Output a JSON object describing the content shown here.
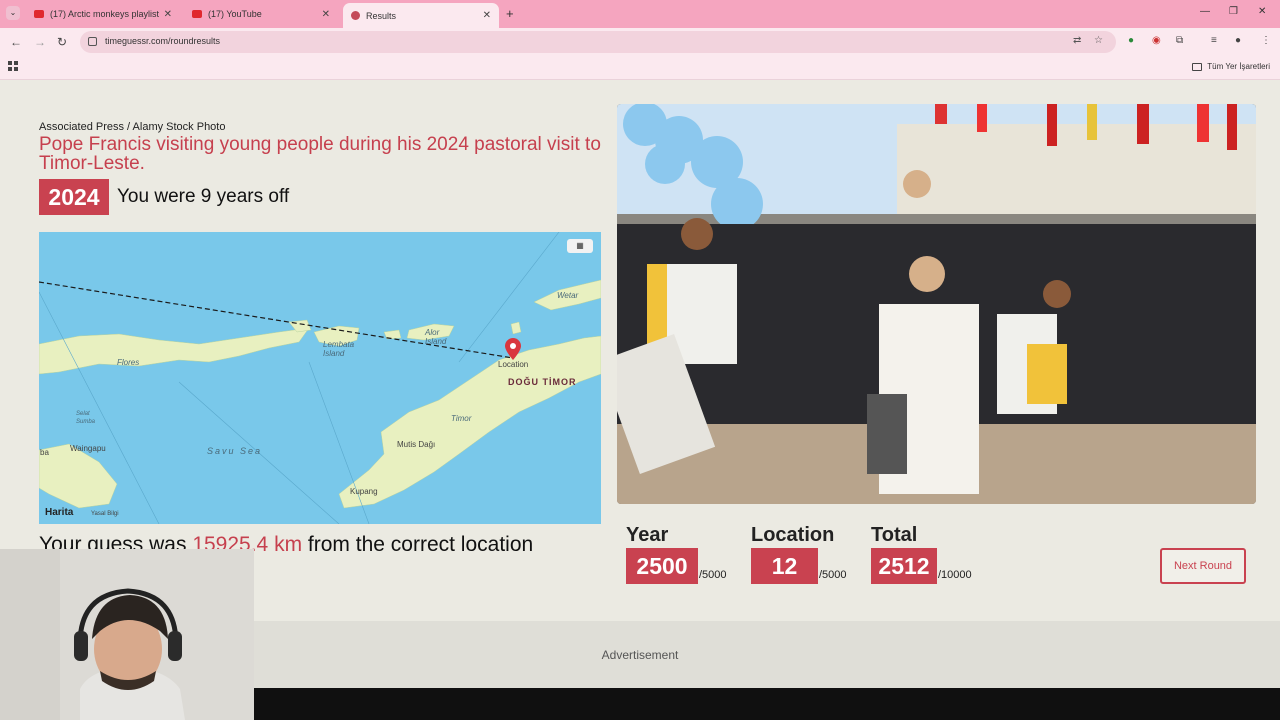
{
  "browser": {
    "tabs": [
      {
        "label": "(17) Arctic monkeys playlist"
      },
      {
        "label": "(17) YouTube"
      },
      {
        "label": "Results"
      }
    ],
    "url": "timeguessr.com/roundresults",
    "all_bookmarks_label": "Tüm Yer İşaretleri"
  },
  "photo_info": {
    "credit": "Associated Press / Alamy Stock Photo",
    "caption": "Pope Francis visiting young people during his 2024 pastoral visit to Timor-Leste."
  },
  "result": {
    "correct_year": "2024",
    "years_off_text": "You were 9 years off",
    "distance_prefix": "Your guess was",
    "distance_value": "15925.4 km",
    "distance_suffix": "from the correct location"
  },
  "map": {
    "labels": {
      "flores": "Flores",
      "lembata": "Lembata Island",
      "alor": "Alor Island",
      "wetar": "Wetar",
      "location": "Location",
      "dogu_timor": "DOĞU TİMOR",
      "timor": "Timor",
      "savu_sea": "Savu Sea",
      "mutis": "Mutis Dağı",
      "kupang": "Kupang",
      "waingapu": "Waingapu",
      "selat_sumba": "Selat Sumba",
      "sumba_edge": "ba"
    },
    "brand": "Harita",
    "legal": "Yasal Bilgi",
    "toggle_icon": "map-icon"
  },
  "scores": {
    "year": {
      "title": "Year",
      "value": "2500",
      "max": "/5000"
    },
    "location": {
      "title": "Location",
      "value": "12",
      "max": "/5000"
    },
    "total": {
      "title": "Total",
      "value": "2512",
      "max": "/10000"
    }
  },
  "next_round_label": "Next Round",
  "advertisement_label": "Advertisement",
  "colors": {
    "accent": "#c94250",
    "page_bg": "#ebeae2",
    "tabbar": "#f5a5bf",
    "sea": "#79c8ea",
    "land": "#e8f0c0"
  }
}
